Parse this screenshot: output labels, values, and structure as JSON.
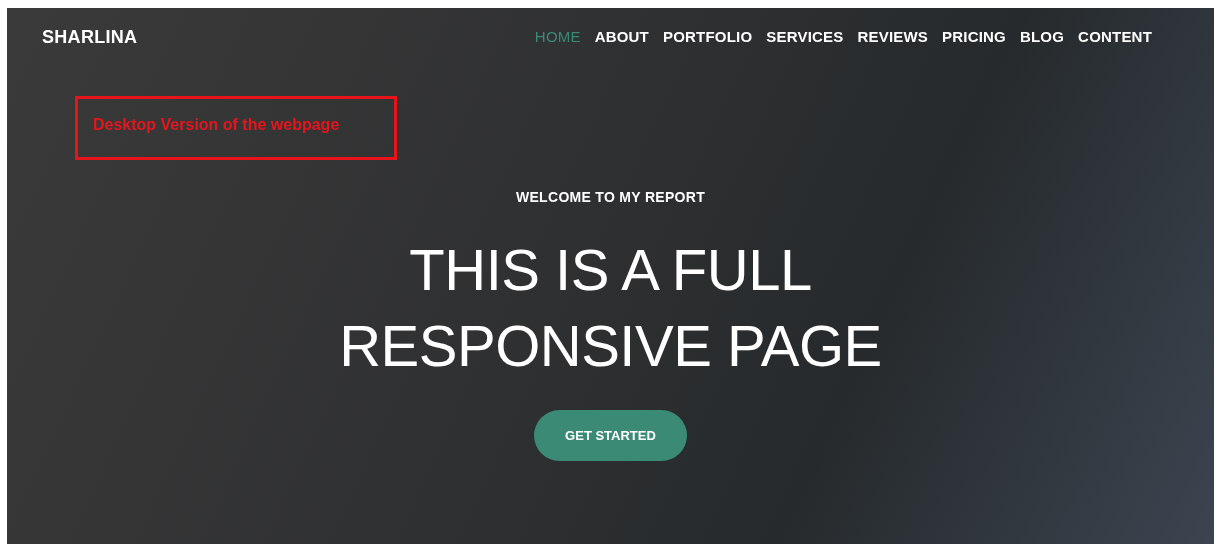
{
  "navbar": {
    "brand": "SHARLINA",
    "links": [
      {
        "label": "HOME",
        "selected": true
      },
      {
        "label": "ABOUT",
        "selected": false
      },
      {
        "label": "PORTFOLIO",
        "selected": false
      },
      {
        "label": "SERVICES",
        "selected": false
      },
      {
        "label": "REVIEWS",
        "selected": false
      },
      {
        "label": "PRICING",
        "selected": false
      },
      {
        "label": "BLOG",
        "selected": false
      },
      {
        "label": "CONTENT",
        "selected": false
      }
    ]
  },
  "annotation": {
    "text": "Desktop Version of the webpage"
  },
  "hero": {
    "eyebrow": "WELCOME TO MY REPORT",
    "heading_lines": [
      "THIS IS A FULL",
      "RESPONSIVE PAGE"
    ],
    "button": "GET STARTED"
  }
}
